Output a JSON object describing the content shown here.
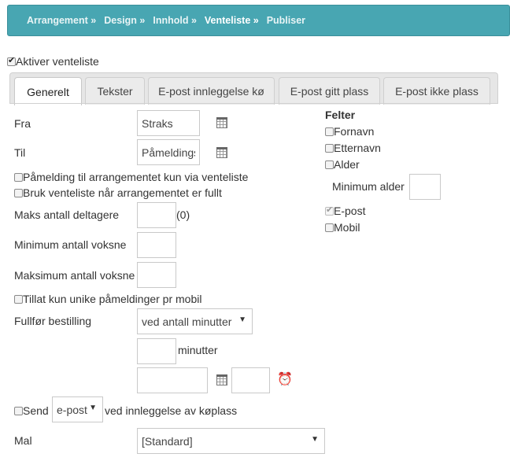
{
  "breadcrumb": {
    "items": [
      {
        "label": "Arrangement »",
        "active": false
      },
      {
        "label": "Design »",
        "active": false
      },
      {
        "label": "Innhold »",
        "active": false
      },
      {
        "label": "Venteliste »",
        "active": true
      },
      {
        "label": "Publiser",
        "active": false
      }
    ]
  },
  "activate_waitlist": {
    "label": "Aktiver venteliste",
    "checked": true
  },
  "tabs": [
    {
      "label": "Generelt",
      "active": true
    },
    {
      "label": "Tekster",
      "active": false
    },
    {
      "label": "E-post innleggelse kø",
      "active": false
    },
    {
      "label": "E-post gitt plass",
      "active": false
    },
    {
      "label": "E-post ikke plass",
      "active": false
    }
  ],
  "form": {
    "fra": {
      "label": "Fra",
      "value": "Straks",
      "icon": "calendar-icon"
    },
    "til": {
      "label": "Til",
      "value": "Påmeldingsslutt",
      "icon": "calendar-icon"
    },
    "only_waitlist": {
      "label": "Påmelding til arrangementet kun via venteliste",
      "checked": false
    },
    "use_when_full": {
      "label": "Bruk venteliste når arrangementet er fullt",
      "checked": false
    },
    "max_participants": {
      "label": "Maks antall deltagere",
      "value": "",
      "hint": "(0)"
    },
    "min_adults": {
      "label": "Minimum antall voksne",
      "value": ""
    },
    "max_adults": {
      "label": "Maksimum antall voksne",
      "value": ""
    },
    "unique_mobile": {
      "label": "Tillat kun unike påmeldinger pr mobil",
      "checked": false
    },
    "complete_order": {
      "label": "Fullfør bestilling",
      "select_value": "ved antall minutter",
      "minutes_value": "",
      "minutes_unit": "minutter",
      "date_value": "",
      "time_value": "",
      "calendar_icon": "calendar-icon",
      "clock_icon": "clock-icon"
    },
    "send": {
      "label": "Send",
      "checked": false,
      "select_value": "e-post",
      "suffix": "ved innleggelse av køplass"
    },
    "template": {
      "label": "Mal",
      "select_value": "[Standard]"
    }
  },
  "fields": {
    "title": "Felter",
    "items": [
      {
        "label": "Fornavn",
        "checked": false,
        "disabled": false
      },
      {
        "label": "Etternavn",
        "checked": false,
        "disabled": false
      },
      {
        "label": "Alder",
        "checked": false,
        "disabled": false
      }
    ],
    "min_age": {
      "label": "Minimum alder",
      "value": ""
    },
    "items2": [
      {
        "label": "E-post",
        "checked": true,
        "disabled": true
      },
      {
        "label": "Mobil",
        "checked": false,
        "disabled": false
      }
    ]
  }
}
